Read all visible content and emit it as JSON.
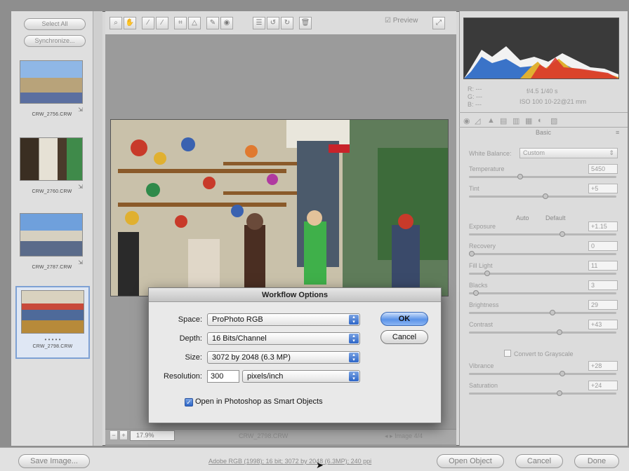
{
  "filmstrip": {
    "select_all": "Select All",
    "synchronize": "Synchronize...",
    "thumbs": [
      {
        "caption": "CRW_2756.CRW"
      },
      {
        "caption": "CRW_2760.CRW"
      },
      {
        "caption": "CRW_2787.CRW"
      },
      {
        "caption": "CRW_2798.CRW"
      }
    ]
  },
  "toolbar": {
    "preview_label": "Preview"
  },
  "statusbar": {
    "zoom": "17.9%",
    "filename": "CRW_2798.CRW",
    "image_count": "Image 4/4"
  },
  "info": {
    "r": "R:  ---",
    "g": "G:  ---",
    "b": "B:  ---",
    "aperture_shutter": "f/4.5   1/40 s",
    "iso_lens": "ISO 100   10-22@21 mm"
  },
  "panel": {
    "title": "Basic",
    "white_balance_label": "White Balance:",
    "white_balance_value": "Custom",
    "auto": "Auto",
    "default": "Default",
    "convert_grayscale": "Convert to Grayscale",
    "sliders": [
      {
        "label": "Temperature",
        "value": "5450",
        "pos": 0.34
      },
      {
        "label": "Tint",
        "value": "+5",
        "pos": 0.52
      },
      {
        "label": "Exposure",
        "value": "+1.15",
        "pos": 0.64
      },
      {
        "label": "Recovery",
        "value": "0",
        "pos": 0.0
      },
      {
        "label": "Fill Light",
        "value": "11",
        "pos": 0.11
      },
      {
        "label": "Blacks",
        "value": "3",
        "pos": 0.03
      },
      {
        "label": "Brightness",
        "value": "29",
        "pos": 0.57
      },
      {
        "label": "Contrast",
        "value": "+43",
        "pos": 0.62
      },
      {
        "label": "Vibrance",
        "value": "+28",
        "pos": 0.64
      },
      {
        "label": "Saturation",
        "value": "+24",
        "pos": 0.62
      }
    ]
  },
  "dialog": {
    "title": "Workflow Options",
    "space_label": "Space:",
    "space_value": "ProPhoto RGB",
    "depth_label": "Depth:",
    "depth_value": "16 Bits/Channel",
    "size_label": "Size:",
    "size_value": "3072 by 2048  (6.3 MP)",
    "resolution_label": "Resolution:",
    "resolution_value": "300",
    "resolution_unit": "pixels/inch",
    "smart_objects_label": "Open in Photoshop as Smart Objects",
    "ok": "OK",
    "cancel": "Cancel"
  },
  "bottom": {
    "save_image": "Save Image...",
    "workflow_link": "Adobe RGB (1998); 16 bit; 3072 by 2048 (6.3MP); 240 ppi",
    "open_object": "Open Object",
    "cancel": "Cancel",
    "done": "Done"
  }
}
